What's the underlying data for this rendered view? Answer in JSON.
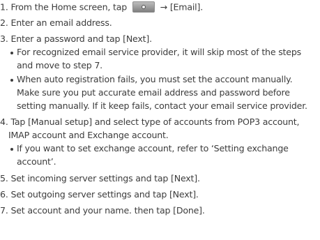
{
  "steps": [
    {
      "num": "1.",
      "pre": "From the Home screen, tap",
      "arrow": "→",
      "post": "[Email]."
    },
    {
      "num": "2.",
      "text": "Enter an email address."
    },
    {
      "num": "3.",
      "text": "Enter a password and tap [Next]."
    },
    {
      "num": "4.",
      "text": "Tap [Manual setup] and select type of accounts from POP3 account,",
      "text2": "IMAP account and Exchange account."
    },
    {
      "num": "5.",
      "text": "Set incoming server settings and tap [Next]."
    },
    {
      "num": "6.",
      "text": "Set outgoing server settings and tap [Next]."
    },
    {
      "num": "7.",
      "text": "Set account and your name. then tap [Done]."
    }
  ],
  "step3_bullets": [
    [
      "For recognized email service provider, it will skip most of the steps",
      "and move to step 7."
    ],
    [
      "When auto registration fails, you must set the account manually.",
      "Make sure you put accurate email address and password before",
      "setting manually. If it keep fails, contact your email service provider."
    ]
  ],
  "step4_bullets": [
    [
      "If you want to set exchange account, refer to ‘Setting exchange",
      "account’."
    ]
  ],
  "icons": {
    "home_apps_button": "apps-button-icon"
  }
}
